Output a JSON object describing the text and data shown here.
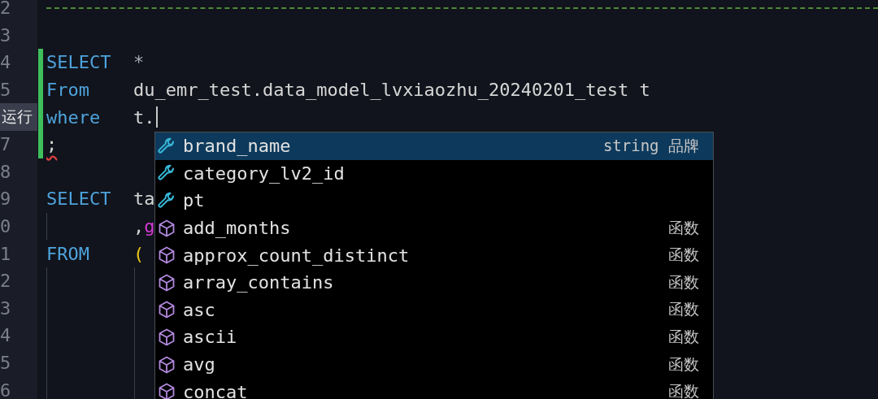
{
  "lines": [
    {
      "number": "2",
      "kind": "rule",
      "changed": false,
      "outer_guide": false,
      "inner_guide": false
    },
    {
      "number": "3",
      "kind": "code",
      "changed": false,
      "outer_guide": false,
      "inner_guide": false
    },
    {
      "number": "4",
      "kind": "code",
      "changed": true,
      "outer_guide": false,
      "inner_guide": false,
      "keyword": "SELECT",
      "tokens": [
        {
          "text": "*",
          "kind": "star"
        }
      ]
    },
    {
      "number": "5",
      "kind": "code",
      "changed": true,
      "outer_guide": false,
      "inner_guide": false,
      "keyword": "From",
      "tokens": [
        {
          "text": "du_emr_test.data_model_lvxiaozhu_20240201_test t",
          "kind": "ident"
        }
      ]
    },
    {
      "kind": "code",
      "changed": true,
      "outer_guide": false,
      "inner_guide": false,
      "gutter_action": "运行",
      "keyword": "where",
      "cursor": true,
      "tokens": [
        {
          "text": "t.",
          "kind": "ident"
        }
      ]
    },
    {
      "number": "7",
      "kind": "code",
      "changed": true,
      "outer_guide": false,
      "inner_guide": false,
      "indented": false,
      "tokens": [
        {
          "text": ";",
          "kind": "error"
        }
      ]
    },
    {
      "number": "8",
      "kind": "code",
      "changed": false,
      "outer_guide": false,
      "inner_guide": false
    },
    {
      "number": "9",
      "kind": "code",
      "changed": false,
      "outer_guide": false,
      "inner_guide": false,
      "keyword": "SELECT",
      "tokens": [
        {
          "text": "ta",
          "kind": "ident"
        }
      ]
    },
    {
      "number": "0",
      "kind": "code",
      "changed": false,
      "outer_guide": true,
      "inner_guide": false,
      "indented": true,
      "tokens": [
        {
          "text": ",",
          "kind": "ident"
        },
        {
          "text": "g",
          "kind": "func"
        }
      ]
    },
    {
      "number": "1",
      "kind": "code",
      "changed": false,
      "outer_guide": false,
      "inner_guide": false,
      "keyword": "FROM",
      "tokens": [
        {
          "text": "(",
          "kind": "paren"
        }
      ]
    },
    {
      "number": "2",
      "kind": "code",
      "changed": false,
      "outer_guide": true,
      "inner_guide": true
    },
    {
      "number": "3",
      "kind": "code",
      "changed": false,
      "outer_guide": true,
      "inner_guide": true
    },
    {
      "number": "4",
      "kind": "code",
      "changed": false,
      "outer_guide": true,
      "inner_guide": true
    },
    {
      "number": "5",
      "kind": "code",
      "changed": false,
      "outer_guide": true,
      "inner_guide": true
    },
    {
      "number": "6",
      "kind": "code",
      "changed": false,
      "outer_guide": true,
      "inner_guide": true
    }
  ],
  "suggestions": [
    {
      "label": "brand_name",
      "kind": "field",
      "detail": "string 品牌",
      "selected": true
    },
    {
      "label": "category_lv2_id",
      "kind": "field",
      "selected": false
    },
    {
      "label": "pt",
      "kind": "field",
      "selected": false
    },
    {
      "label": "add_months",
      "kind": "function",
      "detail": "函数",
      "selected": false
    },
    {
      "label": "approx_count_distinct",
      "kind": "function",
      "detail": "函数",
      "selected": false
    },
    {
      "label": "array_contains",
      "kind": "function",
      "detail": "函数",
      "selected": false
    },
    {
      "label": "asc",
      "kind": "function",
      "detail": "函数",
      "selected": false
    },
    {
      "label": "ascii",
      "kind": "function",
      "detail": "函数",
      "selected": false
    },
    {
      "label": "avg",
      "kind": "function",
      "detail": "函数",
      "selected": false
    },
    {
      "label": "concat",
      "kind": "function",
      "detail": "函数",
      "selected": false
    }
  ]
}
